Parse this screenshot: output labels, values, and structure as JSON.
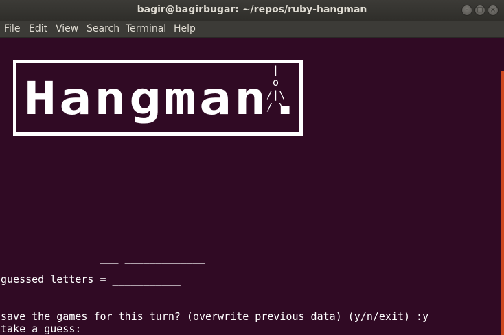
{
  "window": {
    "title": "bagir@bagirbugar: ~/repos/ruby-hangman",
    "buttons": {
      "minimize_icon": "minimize-icon",
      "maximize_icon": "maximize-icon",
      "close_icon": "close-icon"
    }
  },
  "menu": {
    "items": [
      "File",
      "Edit",
      "View",
      "Search",
      "Terminal",
      "Help"
    ]
  },
  "terminal": {
    "logo_text": "Hangman.",
    "gallows_art": " |\n o\n/|\\\n/ \\",
    "word_line": "                ___ _____________",
    "guessed_line": "guessed letters = ___________",
    "save_prompt": "save the games for this turn? (overwrite previous data) (y/n/exit) :y",
    "take_guess": "take a guess:"
  },
  "colors": {
    "terminal_bg": "#300a24",
    "scrollbar": "#e95420",
    "titlebar": "#3c3b37"
  }
}
